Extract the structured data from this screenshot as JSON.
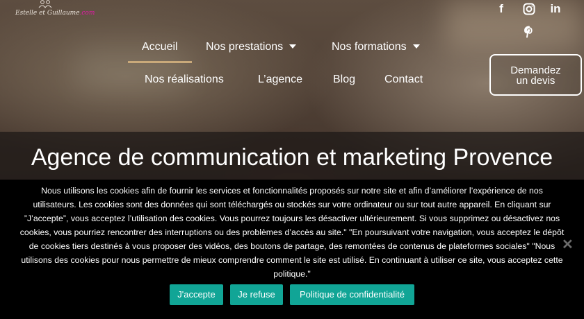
{
  "logo": {
    "text_main": "Estelle et Guillaume",
    "text_suffix": ".com"
  },
  "socials": [
    {
      "icon": "facebook-icon",
      "glyph": "f"
    },
    {
      "icon": "instagram-icon",
      "glyph": "◎"
    },
    {
      "icon": "linkedin-icon",
      "glyph": "in"
    },
    {
      "icon": "pinterest-icon",
      "glyph": "℗"
    }
  ],
  "nav": {
    "accueil": "Accueil",
    "prestations": "Nos prestations",
    "formations": "Nos formations",
    "realisations": "Nos réalisations",
    "agence": "L’agence",
    "blog": "Blog",
    "contact": "Contact",
    "active_color": "#c9a97a"
  },
  "cta": {
    "line1": "Demandez",
    "line2": "un devis"
  },
  "hero": {
    "title": "Agence de communication et marketing Provence"
  },
  "cookie": {
    "text": "Nous utilisons les cookies afin de fournir les services et fonctionnalités proposés sur notre site et afin d’améliorer l’expérience de nos utilisateurs. Les cookies sont des données qui sont téléchargés ou stockés sur votre ordinateur ou sur tout autre appareil. En cliquant sur ”J’accepte”, vous acceptez l’utilisation des cookies. Vous pourrez toujours les désactiver ultérieurement. Si vous supprimez ou désactivez nos cookies, vous pourriez rencontrer des interruptions ou des problèmes d’accès au site.\" \"En poursuivant votre navigation, vous acceptez le dépôt de cookies tiers destinés à vous proposer des vidéos, des boutons de partage, des remontées de contenus de plateformes sociales\" \"Nous utilisons des cookies pour nous permettre de mieux comprendre comment le site est utilisé. En continuant à utiliser ce site, vous acceptez cette politique.\"",
    "accept": "J'accepte",
    "refuse": "Je refuse",
    "policy": "Politique de confidentialité",
    "button_color": "#11a596",
    "close_icon": "close-icon"
  }
}
